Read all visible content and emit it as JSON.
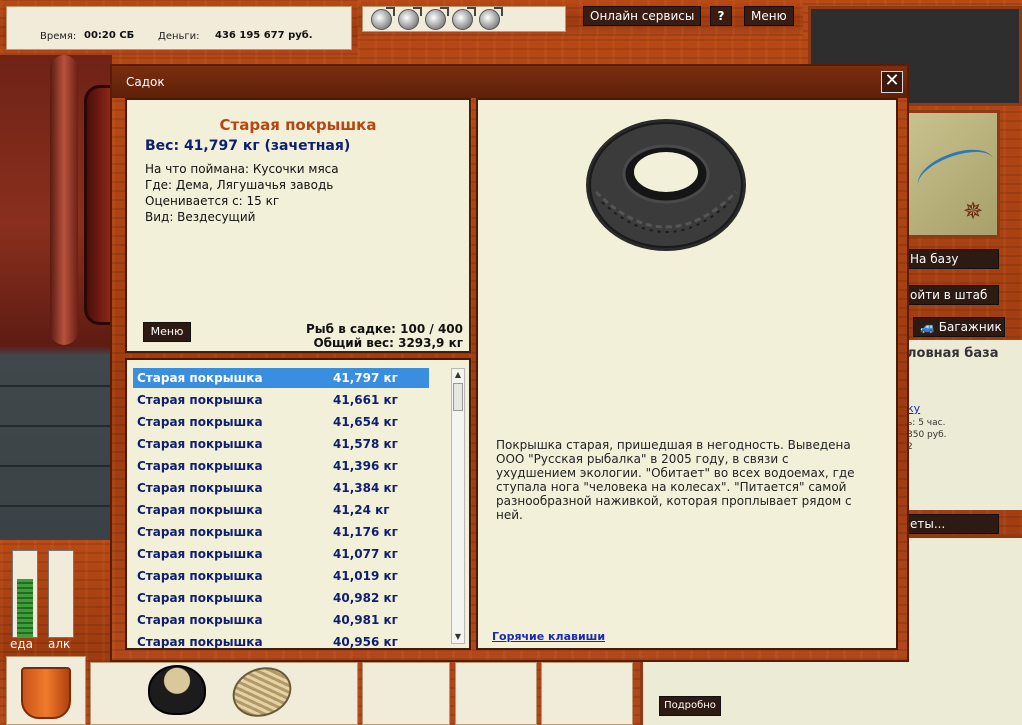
{
  "top_bar": {
    "time_label": "Время:",
    "time_value": "00:20 СБ",
    "money_label": "Деньги:",
    "money_value": "436 195 677 руб.",
    "lure_slots": [
      "lure-icon",
      "lure-icon",
      "lure-icon",
      "lure-icon",
      "lure-icon"
    ],
    "online_services_label": "Онлайн сервисы",
    "help_label": "?",
    "menu_label": "Меню"
  },
  "right_side": {
    "to_base_label": "На базу",
    "to_hq_label": "ойти в штаб",
    "trunk_label": "Багажник",
    "info_title": "ловная база",
    "info_link": "ку",
    "info_line1": "ь: 5 час.",
    "info_line2": "350 руб.",
    "info_line3": "2",
    "tickets_label": "еты...",
    "more_label": "Подробно"
  },
  "status": {
    "food_label": "еда",
    "alcohol_label": "алк",
    "food_level": 0.68,
    "alcohol_level": 0.0
  },
  "modal": {
    "title": "Садок",
    "close_label": "✕",
    "selected": {
      "name": "Старая покрышка",
      "weight_line": "Вес: 41,797 кг (зачетная)",
      "caught_on": "На что поймана: Кусочки мяса",
      "where": "Где: Дема, Лягушачья заводь",
      "rated_from": "Оценивается с: 15 кг",
      "species": "Вид: Вездесущий"
    },
    "menu_label": "Меню",
    "fish_count": "Рыб в садке: 100 / 400",
    "total_weight": "Общий вес: 3293,9 кг",
    "list": [
      {
        "name": "Старая покрышка",
        "weight": "41,797 кг"
      },
      {
        "name": "Старая покрышка",
        "weight": "41,661 кг"
      },
      {
        "name": "Старая покрышка",
        "weight": "41,654 кг"
      },
      {
        "name": "Старая покрышка",
        "weight": "41,578 кг"
      },
      {
        "name": "Старая покрышка",
        "weight": "41,396 кг"
      },
      {
        "name": "Старая покрышка",
        "weight": "41,384 кг"
      },
      {
        "name": "Старая покрышка",
        "weight": "41,24 кг"
      },
      {
        "name": "Старая покрышка",
        "weight": "41,176 кг"
      },
      {
        "name": "Старая покрышка",
        "weight": "41,077 кг"
      },
      {
        "name": "Старая покрышка",
        "weight": "41,019 кг"
      },
      {
        "name": "Старая покрышка",
        "weight": "40,982 кг"
      },
      {
        "name": "Старая покрышка",
        "weight": "40,981 кг"
      },
      {
        "name": "Старая покрышка",
        "weight": "40,956 кг"
      }
    ],
    "description": "Покрышка старая, пришедшая в негодность. Выведена ООО \"Русская рыбалка\" в 2005 году, в связи с ухудшением экологии. \"Обитает\" во всех водоемах, где ступала нога \"человека на колесах\". \"Питается\" самой разнообразной наживкой, которая проплывает рядом с ней.",
    "hotkeys_label": "Горячие клавиши"
  }
}
